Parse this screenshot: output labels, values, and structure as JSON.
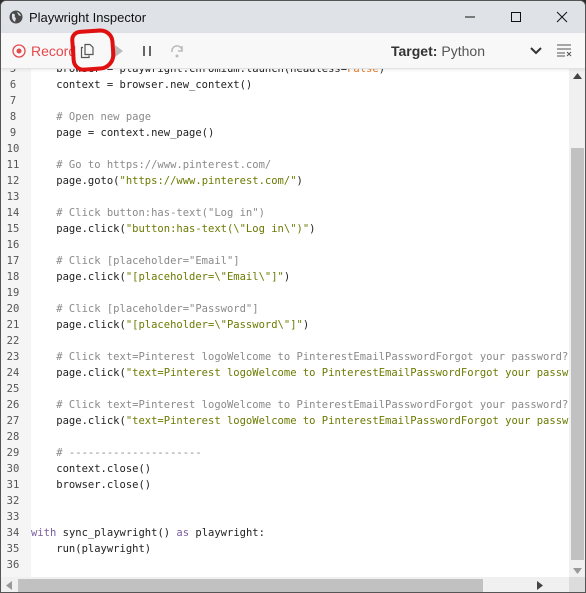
{
  "window": {
    "title": "Playwright Inspector",
    "icons": {
      "app": "globe-icon",
      "minimize": "minimize-icon",
      "maximize": "maximize-icon",
      "close": "close-icon"
    }
  },
  "toolbar": {
    "record_label": "Record",
    "record_color": "#e5484d",
    "buttons": [
      "copy-icon",
      "resume-icon",
      "pause-icon",
      "step-over-icon"
    ],
    "target_label": "Target:",
    "target_value": "Python",
    "annotation_color": "#e01010"
  },
  "code": {
    "lines": [
      {
        "n": "5",
        "segments": [
          {
            "t": "    browser = playwright.chromium.launch(headless=",
            "c": ""
          },
          {
            "t": "False",
            "c": "bool"
          },
          {
            "t": ")",
            "c": ""
          }
        ]
      },
      {
        "n": "6",
        "segments": [
          {
            "t": "    context = browser.new_context()",
            "c": ""
          }
        ]
      },
      {
        "n": "7",
        "segments": []
      },
      {
        "n": "8",
        "segments": [
          {
            "t": "    # Open new page",
            "c": "com"
          }
        ]
      },
      {
        "n": "9",
        "segments": [
          {
            "t": "    page = context.new_page()",
            "c": ""
          }
        ]
      },
      {
        "n": "10",
        "segments": []
      },
      {
        "n": "11",
        "segments": [
          {
            "t": "    # Go to https://www.pinterest.com/",
            "c": "com"
          }
        ]
      },
      {
        "n": "12",
        "segments": [
          {
            "t": "    page.goto(",
            "c": ""
          },
          {
            "t": "\"https://www.pinterest.com/\"",
            "c": "str"
          },
          {
            "t": ")",
            "c": ""
          }
        ]
      },
      {
        "n": "13",
        "segments": []
      },
      {
        "n": "14",
        "segments": [
          {
            "t": "    # Click button:has-text(\"Log in\")",
            "c": "com"
          }
        ]
      },
      {
        "n": "15",
        "segments": [
          {
            "t": "    page.click(",
            "c": ""
          },
          {
            "t": "\"button:has-text(\\\"Log in\\\")\"",
            "c": "str"
          },
          {
            "t": ")",
            "c": ""
          }
        ]
      },
      {
        "n": "16",
        "segments": []
      },
      {
        "n": "17",
        "segments": [
          {
            "t": "    # Click [placeholder=\"Email\"]",
            "c": "com"
          }
        ]
      },
      {
        "n": "18",
        "segments": [
          {
            "t": "    page.click(",
            "c": ""
          },
          {
            "t": "\"[placeholder=\\\"Email\\\"]\"",
            "c": "str"
          },
          {
            "t": ")",
            "c": ""
          }
        ]
      },
      {
        "n": "19",
        "segments": []
      },
      {
        "n": "20",
        "segments": [
          {
            "t": "    # Click [placeholder=\"Password\"]",
            "c": "com"
          }
        ]
      },
      {
        "n": "21",
        "segments": [
          {
            "t": "    page.click(",
            "c": ""
          },
          {
            "t": "\"[placeholder=\\\"Password\\\"]\"",
            "c": "str"
          },
          {
            "t": ")",
            "c": ""
          }
        ]
      },
      {
        "n": "22",
        "segments": []
      },
      {
        "n": "23",
        "segments": [
          {
            "t": "    # Click text=Pinterest logoWelcome to PinterestEmailPasswordForgot your password?Log",
            "c": "com"
          }
        ]
      },
      {
        "n": "24",
        "segments": [
          {
            "t": "    page.click(",
            "c": ""
          },
          {
            "t": "\"text=Pinterest logoWelcome to PinterestEmailPasswordForgot your password?",
            "c": "str"
          }
        ]
      },
      {
        "n": "25",
        "segments": []
      },
      {
        "n": "26",
        "segments": [
          {
            "t": "    # Click text=Pinterest logoWelcome to PinterestEmailPasswordForgot your password?Log",
            "c": "com"
          }
        ]
      },
      {
        "n": "27",
        "segments": [
          {
            "t": "    page.click(",
            "c": ""
          },
          {
            "t": "\"text=Pinterest logoWelcome to PinterestEmailPasswordForgot your password?",
            "c": "str"
          }
        ]
      },
      {
        "n": "28",
        "segments": []
      },
      {
        "n": "29",
        "segments": [
          {
            "t": "    # ---------------------",
            "c": "com"
          }
        ]
      },
      {
        "n": "30",
        "segments": [
          {
            "t": "    context.close()",
            "c": ""
          }
        ]
      },
      {
        "n": "31",
        "segments": [
          {
            "t": "    browser.close()",
            "c": ""
          }
        ]
      },
      {
        "n": "32",
        "segments": []
      },
      {
        "n": "33",
        "segments": []
      },
      {
        "n": "34",
        "segments": [
          {
            "t": "with",
            "c": "kw"
          },
          {
            "t": " sync_playwright() ",
            "c": ""
          },
          {
            "t": "as",
            "c": "kw"
          },
          {
            "t": " playwright:",
            "c": ""
          }
        ]
      },
      {
        "n": "35",
        "segments": [
          {
            "t": "    run(playwright)",
            "c": ""
          }
        ]
      },
      {
        "n": "36",
        "segments": []
      }
    ]
  }
}
